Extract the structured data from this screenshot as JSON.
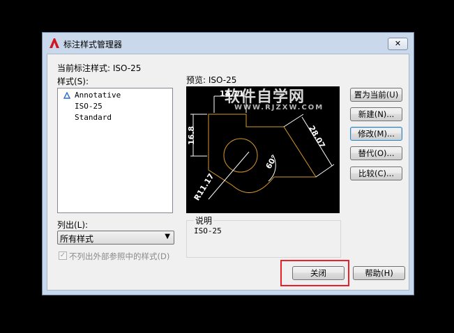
{
  "window": {
    "title": "标注样式管理器",
    "close_glyph": "✕"
  },
  "current_style": {
    "label": "当前标注样式: ISO-25"
  },
  "styles": {
    "label": "样式(S):",
    "items": [
      {
        "name": "Annotative",
        "icon": "annotative-icon"
      },
      {
        "name": "ISO-25"
      },
      {
        "name": "Standard"
      }
    ]
  },
  "list_filter": {
    "label": "列出(L):",
    "selected": "所有样式"
  },
  "xref_checkbox": {
    "label": "不列出外部参照中的样式(D)",
    "checked": true,
    "disabled": true
  },
  "preview": {
    "label": "预览: ISO-25",
    "dims": {
      "top": "14.11",
      "left": "16.8",
      "right": "28.07",
      "angle": "60°",
      "radius": "R11.17"
    },
    "line_color": "#d89a2a",
    "dim_color": "#ffffff"
  },
  "description": {
    "label": "说明",
    "text": "ISO-25"
  },
  "buttons": {
    "set_current": "置为当前(U)",
    "new": "新建(N)...",
    "modify": "修改(M)...",
    "override": "替代(O)...",
    "compare": "比较(C)...",
    "close": "关闭",
    "help": "帮助(H)"
  },
  "watermark": {
    "line1": "软件自学网",
    "line2": "WWW.RJZXW.COM"
  },
  "colors": {
    "highlight": "#e8202a",
    "title_bg": "#c9d8ea",
    "app_red": "#d0161f"
  }
}
